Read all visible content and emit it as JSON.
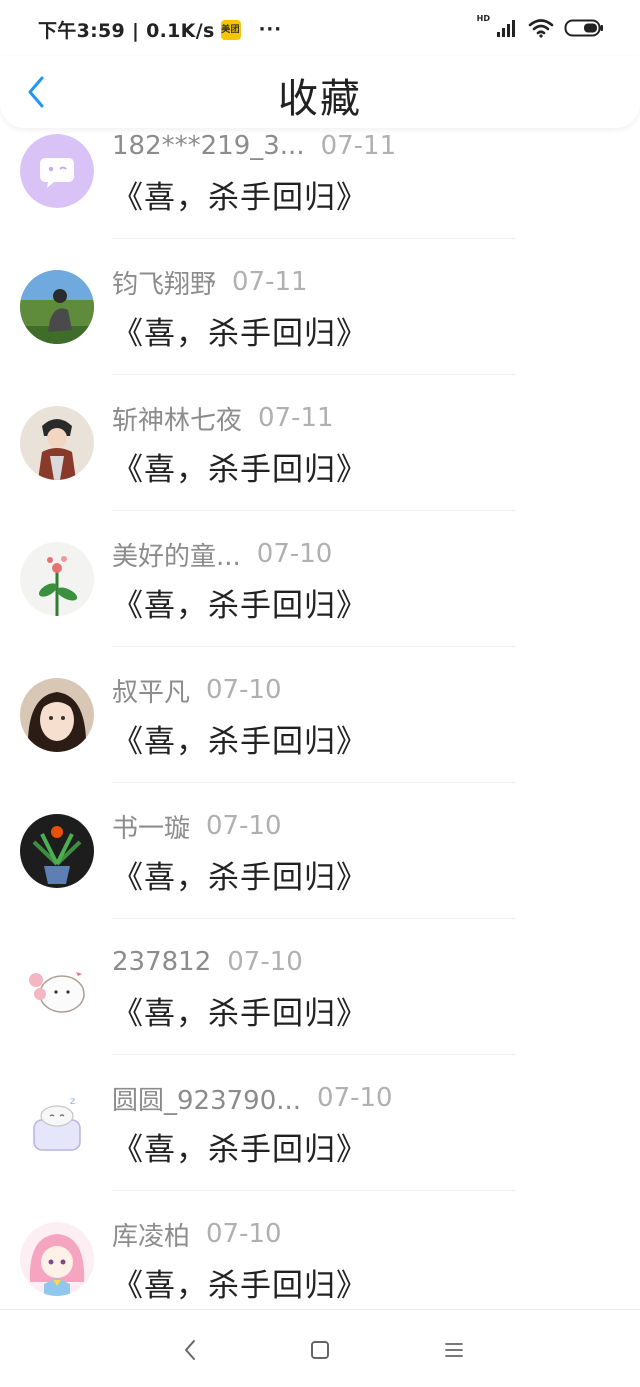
{
  "status_bar": {
    "time_speed": "下午3:59 | 0.1K/s",
    "app_badge": "美团",
    "more": "···",
    "network_label": "HD"
  },
  "header": {
    "title": "收藏"
  },
  "items": [
    {
      "user": "182***219_3...",
      "date": "07-11",
      "title": "《喜，杀手回归》"
    },
    {
      "user": "钧飞翔野",
      "date": "07-11",
      "title": "《喜，杀手回归》"
    },
    {
      "user": "斩神林七夜",
      "date": "07-11",
      "title": "《喜，杀手回归》"
    },
    {
      "user": "美好的童...",
      "date": "07-10",
      "title": "《喜，杀手回归》"
    },
    {
      "user": "叔平凡",
      "date": "07-10",
      "title": "《喜，杀手回归》"
    },
    {
      "user": "书一璇",
      "date": "07-10",
      "title": "《喜，杀手回归》"
    },
    {
      "user": "237812",
      "date": "07-10",
      "title": "《喜，杀手回归》"
    },
    {
      "user": "圆圆_923790...",
      "date": "07-10",
      "title": "《喜，杀手回归》"
    },
    {
      "user": "库凌柏",
      "date": "07-10",
      "title": "《喜，杀手回归》"
    }
  ],
  "colors": {
    "accent": "#2196f3",
    "text_primary": "#222222",
    "text_secondary": "#8c8c8c"
  }
}
